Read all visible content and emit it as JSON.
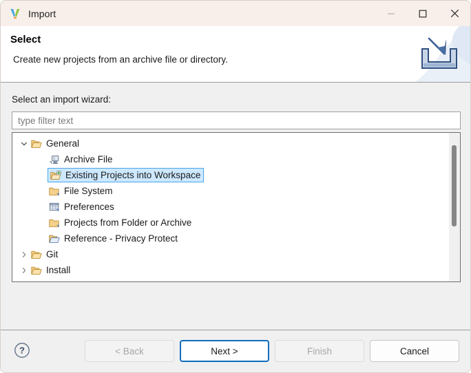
{
  "window": {
    "title": "Import",
    "app_icon": "eclipse-v-icon",
    "controls": {
      "minimize": "minimize-icon",
      "maximize": "maximize-icon",
      "close": "close-icon"
    }
  },
  "banner": {
    "title": "Select",
    "description": "Create new projects from an archive file or directory.",
    "icon": "import-tray-icon"
  },
  "form": {
    "wizard_label": "Select an import wizard:",
    "filter": {
      "placeholder": "type filter text",
      "value": ""
    }
  },
  "tree": {
    "rows": [
      {
        "label": "General",
        "icon": "folder-open-icon",
        "twisty": "chevron-down",
        "depth": 0,
        "selected": false
      },
      {
        "label": "Archive File",
        "icon": "archive-file-icon",
        "twisty": "none",
        "depth": 1,
        "selected": false
      },
      {
        "label": "Existing Projects into Workspace",
        "icon": "folder-import-icon",
        "twisty": "none",
        "depth": 1,
        "selected": true
      },
      {
        "label": "File System",
        "icon": "folder-closed-icon",
        "twisty": "none",
        "depth": 1,
        "selected": false
      },
      {
        "label": "Preferences",
        "icon": "preferences-sheet-icon",
        "twisty": "none",
        "depth": 1,
        "selected": false
      },
      {
        "label": "Projects from Folder or Archive",
        "icon": "folder-closed-icon",
        "twisty": "none",
        "depth": 1,
        "selected": false
      },
      {
        "label": "Reference - Privacy Protect",
        "icon": "folder-open-blue-icon",
        "twisty": "none",
        "depth": 1,
        "selected": false
      },
      {
        "label": "Git",
        "icon": "folder-open-icon",
        "twisty": "chevron-right",
        "depth": 0,
        "selected": false
      },
      {
        "label": "Install",
        "icon": "folder-open-icon",
        "twisty": "chevron-right",
        "depth": 0,
        "selected": false
      }
    ],
    "scrollbar": {
      "visible": true
    }
  },
  "footer": {
    "help_icon": "help-circle-icon",
    "buttons": [
      {
        "label": "< Back",
        "state": "disabled"
      },
      {
        "label": "Next >",
        "state": "default"
      },
      {
        "label": "Finish",
        "state": "disabled"
      },
      {
        "label": "Cancel",
        "state": "enabled"
      }
    ]
  },
  "colors": {
    "titlebar": "#f8efea",
    "body": "#f0f0f0",
    "selection_fill": "#cde8ff",
    "selection_border": "#4ba5e8",
    "default_button_border": "#0f6cbd",
    "folder": "#dba94e",
    "banner_icon": "#3a5f96"
  }
}
